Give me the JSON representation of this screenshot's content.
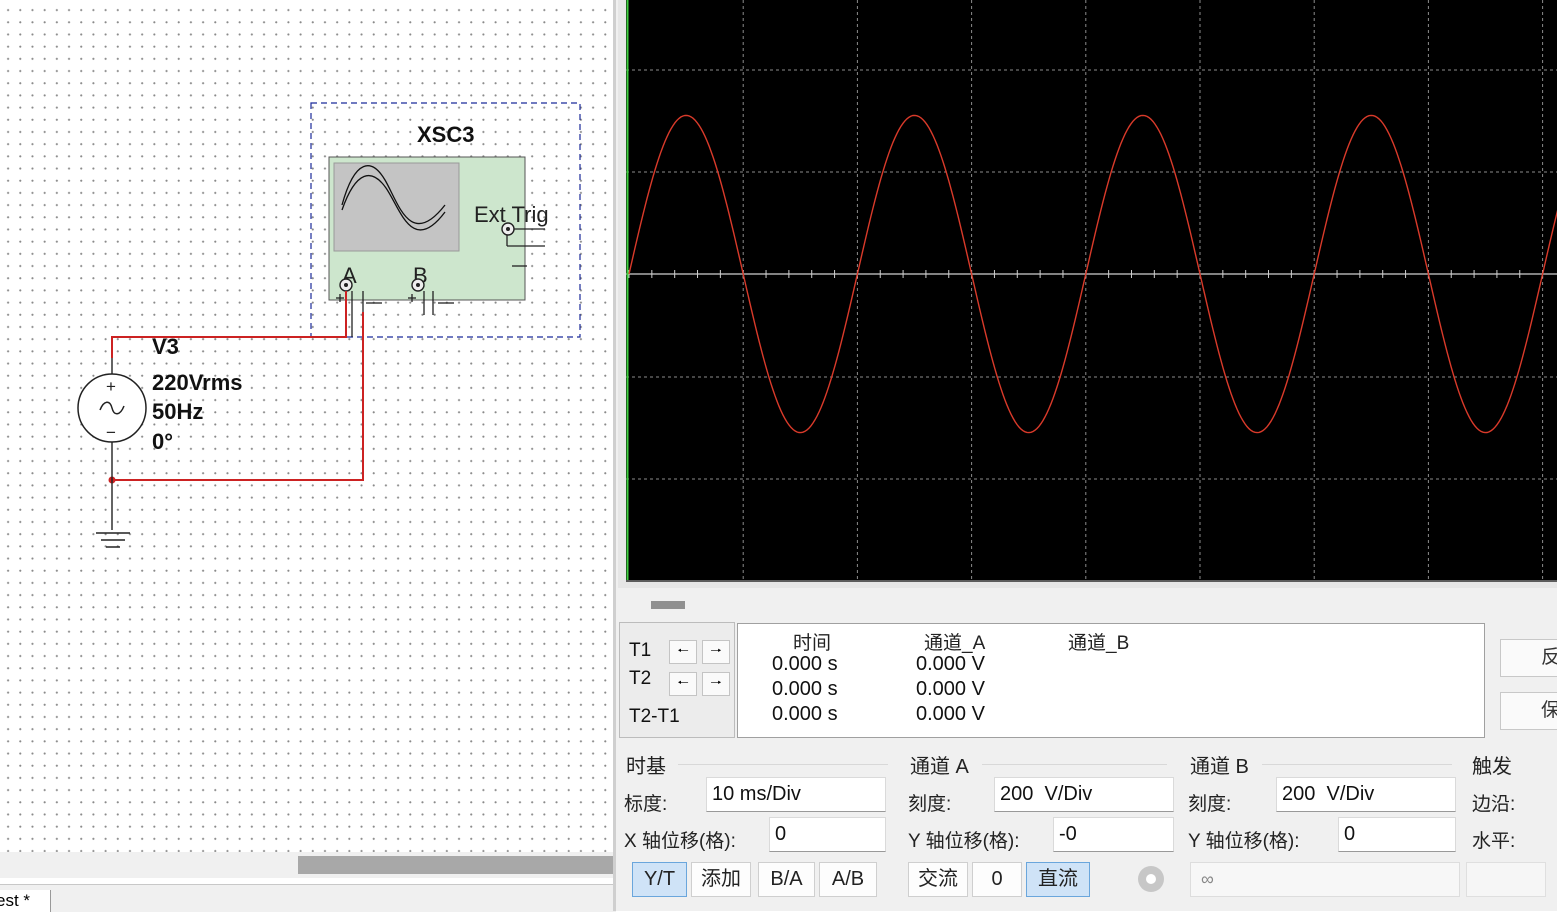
{
  "schematic": {
    "scope_name": "XSC3",
    "ext_trig_label": "Ext Trig",
    "terminal_a": "A",
    "terminal_b": "B",
    "source_name": "V3",
    "source_voltage": "220Vrms",
    "source_freq": "50Hz",
    "source_phase": "0°",
    "plus_sign": "+",
    "minus_sign": "−"
  },
  "tab_label": "est *",
  "scope": {
    "trace_color": "#d93a2a",
    "readout": {
      "row_labels": [
        "T1",
        "T2",
        "T2-T1"
      ],
      "col_time": "时间",
      "col_a": "通道_A",
      "col_b": "通道_B",
      "times": [
        "0.000 s",
        "0.000 s",
        "0.000 s"
      ],
      "ch_a": [
        "0.000 V",
        "0.000 V",
        "0.000 V"
      ]
    },
    "side_buttons": [
      "反",
      "保"
    ],
    "timebase": {
      "title": "时基",
      "scale_label": "标度:",
      "scale_value": "10 ms/Div",
      "xpos_label": "X 轴位移(格):",
      "xpos_value": "0",
      "btn_yt": "Y/T",
      "btn_add": "添加",
      "btn_ba": "B/A",
      "btn_ab": "A/B"
    },
    "channel_a": {
      "title": "通道 A",
      "scale_label": "刻度:",
      "scale_value": "200  V/Div",
      "ypos_label": "Y 轴位移(格):",
      "ypos_value": "-0",
      "btn_ac": "交流",
      "btn_zero": "0",
      "btn_dc": "直流"
    },
    "channel_b": {
      "title": "通道 B",
      "scale_label": "刻度:",
      "scale_value": "200  V/Div",
      "ypos_label": "Y 轴位移(格):",
      "ypos_value": "0"
    },
    "trigger": {
      "title": "触发",
      "edge_label": "边沿:",
      "level_label": "水平:"
    }
  }
}
